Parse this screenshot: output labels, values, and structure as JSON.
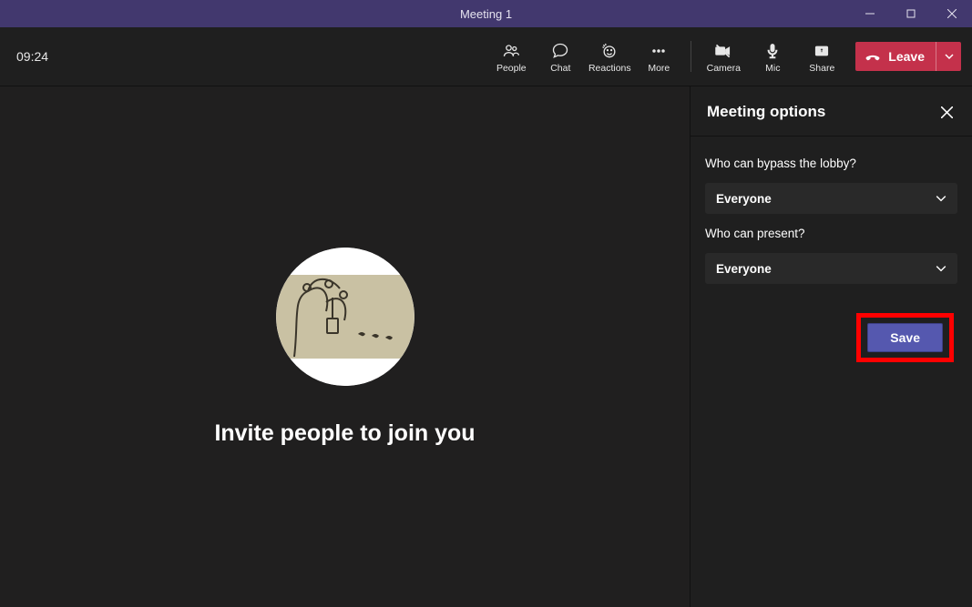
{
  "titlebar": {
    "title": "Meeting 1"
  },
  "toolbar": {
    "time": "09:24",
    "people": "People",
    "chat": "Chat",
    "reactions": "Reactions",
    "more": "More",
    "camera": "Camera",
    "mic": "Mic",
    "share": "Share",
    "leave": "Leave"
  },
  "stage": {
    "invite": "Invite people to join you"
  },
  "panel": {
    "title": "Meeting options",
    "bypass_label": "Who can bypass the lobby?",
    "bypass_value": "Everyone",
    "present_label": "Who can present?",
    "present_value": "Everyone",
    "save": "Save"
  }
}
